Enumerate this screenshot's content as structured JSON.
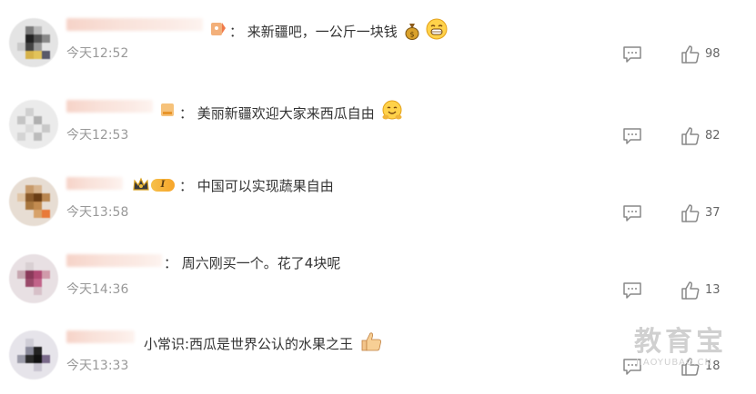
{
  "comments": [
    {
      "text": "：  来新疆吧，一公斤一块钱",
      "time": "今天12:52",
      "likes": "98",
      "emojis": [
        "money-bag",
        "grin"
      ]
    },
    {
      "text": "：  美丽新疆欢迎大家来西瓜自由",
      "time": "今天12:53",
      "likes": "82",
      "emojis": [
        "happy-hug"
      ]
    },
    {
      "text": "：  中国可以实现蔬果自由",
      "time": "今天13:58",
      "likes": "37",
      "emojis": []
    },
    {
      "text": "：  周六刚买一个。花了4块呢",
      "time": "今天14:36",
      "likes": "13",
      "emojis": []
    },
    {
      "text": "小常识:西瓜是世界公认的水果之王",
      "time": "今天13:33",
      "likes": "18",
      "emojis": [
        "thumbs-up"
      ]
    }
  ],
  "badges": {
    "crown_level": "I"
  },
  "watermark": {
    "main": "教育宝",
    "sub": "JIAOYUBAO.CN"
  },
  "colors": {
    "text": "#333333",
    "time": "#999999",
    "icon": "#888888",
    "name_blur": "#f6d3c8"
  }
}
